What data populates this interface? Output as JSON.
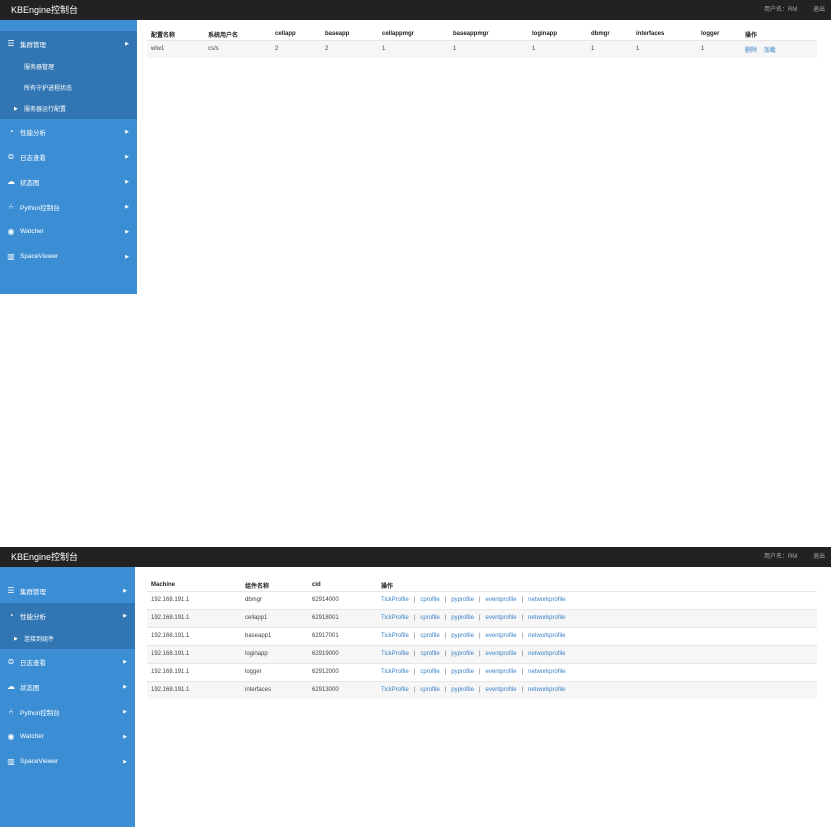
{
  "app": {
    "title": "KBEngine控制台",
    "user": "用户名：RM",
    "logout": "退出"
  },
  "nav1": {
    "cluster": "集群管理",
    "cluster_subs": [
      "服务器管理",
      "所有守护进程状态",
      "服务器运行配置"
    ],
    "perf": "性能分析",
    "log": "日志查看",
    "status": "状态图",
    "python": "Python控制台",
    "watcher": "Watcher",
    "space": "SpaceViewer"
  },
  "config_table": {
    "headers": [
      "配置名称",
      "系统用户名",
      "cellapp",
      "baseapp",
      "cellappmgr",
      "baseappmgr",
      "loginapp",
      "dbmgr",
      "interfaces",
      "logger",
      "操作"
    ],
    "row": [
      "wlw1",
      "cs/s",
      "2",
      "2",
      "1",
      "1",
      "1",
      "1",
      "1",
      "1"
    ],
    "actions": [
      "删除",
      "加载"
    ]
  },
  "nav2": {
    "cluster": "集群管理",
    "perf": "性能分析",
    "perf_sub": "连接到组件",
    "log": "日志查看",
    "status": "状态图",
    "python": "Python控制台",
    "watcher": "Watcher",
    "space": "SpaceViewer"
  },
  "profile_table": {
    "headers": [
      "Machine",
      "组件名称",
      "cid",
      "操作"
    ],
    "rows": [
      [
        "192.168.191.1",
        "dbmgr",
        "62914000"
      ],
      [
        "192.168.191.1",
        "cellapp1",
        "62918001"
      ],
      [
        "192.168.191.1",
        "baseapp1",
        "62917001"
      ],
      [
        "192.168.191.1",
        "loginapp",
        "62919000"
      ],
      [
        "192.168.191.1",
        "logger",
        "62912000"
      ],
      [
        "192.168.191.1",
        "interfaces",
        "62913000"
      ]
    ],
    "links": [
      "TickProfile",
      "cprofile",
      "pyprofile",
      "eventprofile",
      "networkprofile"
    ],
    "separator": "|"
  }
}
